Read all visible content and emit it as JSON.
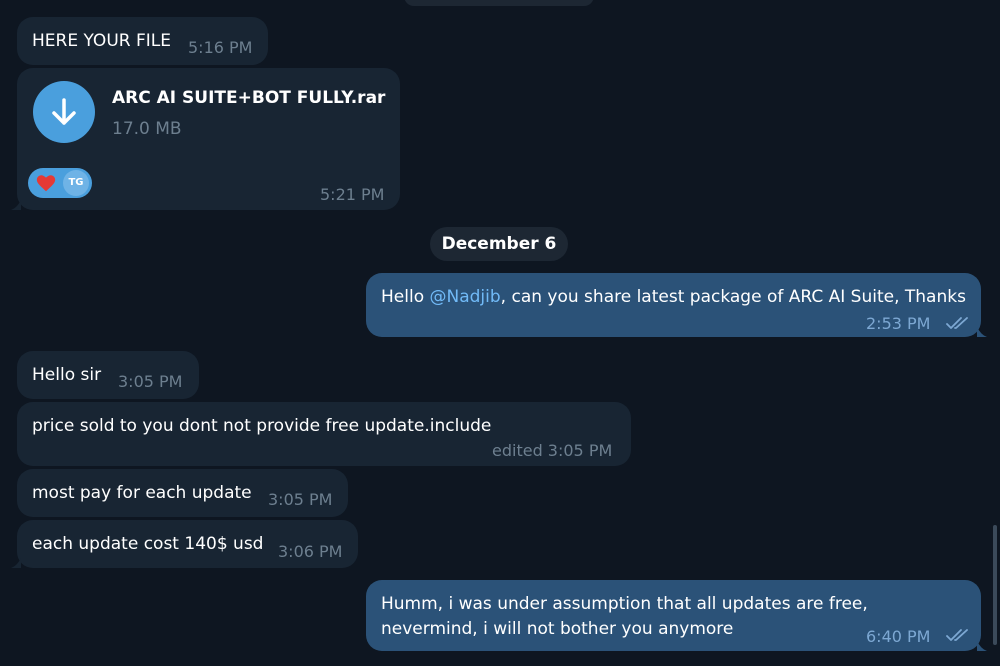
{
  "messages": [
    {
      "text": "HERE YOUR FILE",
      "time": "5:16 PM"
    },
    {
      "file_name": "ARC AI SUITE+BOT FULLY.rar",
      "file_size": "17.0 MB",
      "time": "5:21 PM",
      "reactions": [
        "heart",
        "TG"
      ]
    },
    {
      "text_prefix": "Hello ",
      "mention": "@Nadjib",
      "text_suffix": ", can you share latest package of ARC AI  Suite, Thanks",
      "time": "2:53 PM"
    },
    {
      "text": "Hello sir",
      "time": "3:05 PM"
    },
    {
      "text": "price sold to you dont not provide free update.include",
      "time": "edited 3:05 PM"
    },
    {
      "text": "most pay for each update",
      "time": "3:05 PM"
    },
    {
      "text": "each update cost 140$ usd",
      "time": "3:06 PM"
    },
    {
      "line1": "Humm, i was under assumption that all updates are free,",
      "line2": "nevermind, i will not bother you anymore",
      "time": "6:40 PM"
    }
  ],
  "date_separator": "December 6",
  "reaction_avatar_label": "TG",
  "colors": {
    "background": "#0e1621",
    "incoming_bubble": "#182533",
    "outgoing_bubble": "#2b5278",
    "accent": "#4a9fdd",
    "mention": "#71baf7",
    "time_incoming": "#6d7f8f",
    "time_outgoing": "#7da8d3"
  },
  "icons": {
    "download": "download-arrow-icon",
    "reaction": "heart-icon",
    "read": "double-check-icon"
  }
}
